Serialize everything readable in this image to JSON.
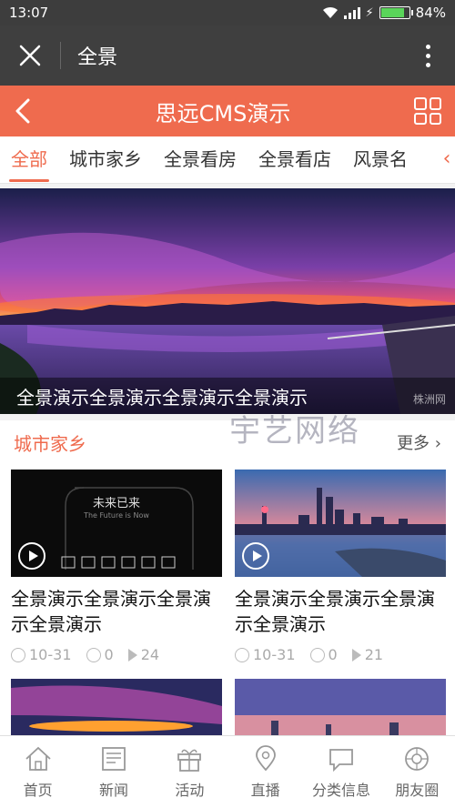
{
  "status": {
    "time": "13:07",
    "battery": "84%"
  },
  "titlebar": {
    "close_label": "✕",
    "title": "全景"
  },
  "header": {
    "title": "思远CMS演示"
  },
  "tabs": [
    {
      "label": "全部"
    },
    {
      "label": "城市家乡"
    },
    {
      "label": "全景看房"
    },
    {
      "label": "全景看店"
    },
    {
      "label": "风景名"
    }
  ],
  "banner": {
    "caption": "全景演示全景演示全景演示全景演示",
    "logo": "株洲网"
  },
  "section": {
    "title": "城市家乡",
    "more": "更多"
  },
  "watermark": "宇艺网络",
  "cards": [
    {
      "title": "全景演示全景演示全景演示全景演示",
      "date": "10-31",
      "comments": "0",
      "views": "24",
      "thumb_text": "未来已来",
      "thumb_sub": "The Future is Now"
    },
    {
      "title": "全景演示全景演示全景演示全景演示",
      "date": "10-31",
      "comments": "0",
      "views": "21"
    }
  ],
  "nav": [
    {
      "label": "首页",
      "icon": "home-icon"
    },
    {
      "label": "新闻",
      "icon": "news-icon"
    },
    {
      "label": "活动",
      "icon": "gift-icon"
    },
    {
      "label": "直播",
      "icon": "location-icon"
    },
    {
      "label": "分类信息",
      "icon": "chat-icon"
    },
    {
      "label": "朋友圈",
      "icon": "moments-icon"
    }
  ],
  "colors": {
    "accent": "#ef6b4e",
    "titlebar": "#3f3f3f"
  }
}
